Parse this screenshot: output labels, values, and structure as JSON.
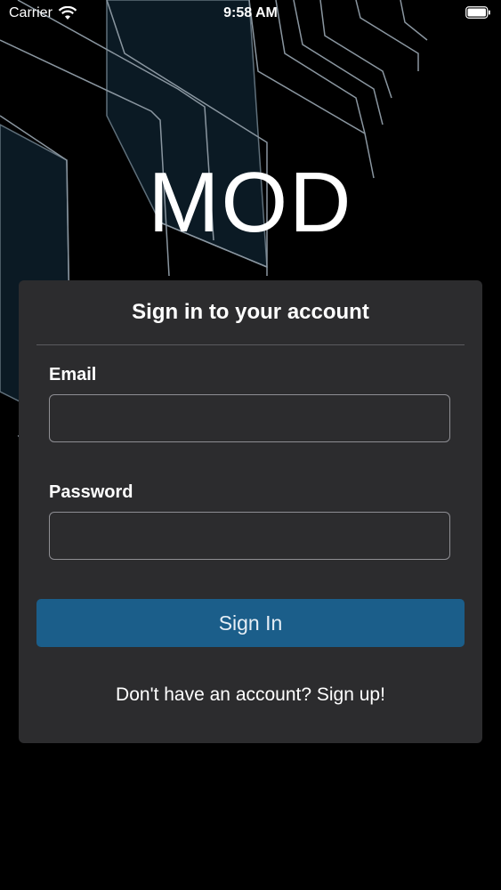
{
  "status_bar": {
    "carrier": "Carrier",
    "time": "9:58 AM",
    "icons": [
      "wifi-icon",
      "battery-icon"
    ]
  },
  "app": {
    "logo_text": "MOD"
  },
  "signin_card": {
    "title": "Sign in to your account",
    "email_label": "Email",
    "email_value": "",
    "password_label": "Password",
    "password_value": "",
    "submit_label": "Sign In",
    "signup_prompt": "Don't have an account? Sign up!"
  },
  "colors": {
    "background": "#000000",
    "card": "#2c2c2e",
    "accent": "#1b5e8a",
    "text": "#ffffff"
  }
}
